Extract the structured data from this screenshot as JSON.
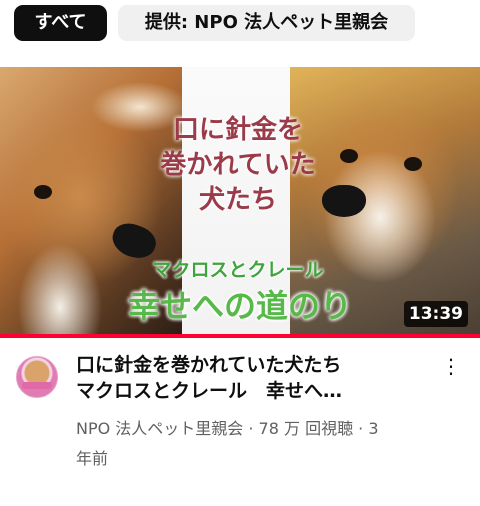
{
  "chips": {
    "all_label": "すべて",
    "source_label": "提供: NPO 法人ペット里親会"
  },
  "thumbnail": {
    "overlay_title_lines": [
      "口に針金を",
      "巻かれていた",
      "犬たち"
    ],
    "overlay_names": "マクロスとクレール",
    "overlay_path": "幸せへの道のり",
    "duration": "13:39",
    "watched_fraction": 1.0,
    "accent_color": "#ff0033"
  },
  "video": {
    "title_line1": "口に針金を巻かれていた犬たち",
    "title_line2": "マクロスとクレール　幸せへ…",
    "subline_line1": "NPO 法人ペット里親会 · 78 万 回視聴 · 3",
    "subline_line2": "年前",
    "menu_icon": "more-vert-icon",
    "channel_icon": "channel-avatar"
  }
}
